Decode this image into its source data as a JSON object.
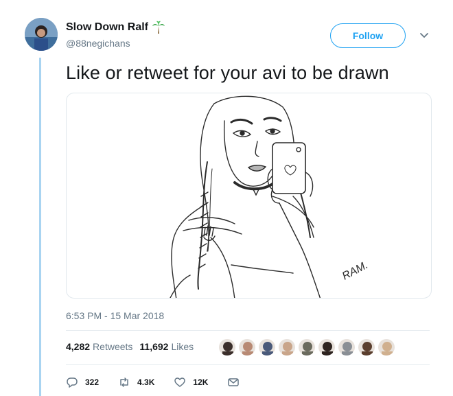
{
  "tweet": {
    "display_name": "Slow Down Ralf",
    "handle": "@88negichans",
    "follow_label": "Follow",
    "text": "Like or retweet for your avi to be drawn",
    "timestamp": "6:53 PM - 15 Mar 2018",
    "media_signature": "RAM.",
    "retweets_count": "4,282",
    "retweets_label": "Retweets",
    "likes_count": "11,692",
    "likes_label": "Likes",
    "liker_colors": [
      "#3b2f2b",
      "#b88a74",
      "#4a5a7a",
      "#c9a58a",
      "#6b6b5e",
      "#2e2420",
      "#8a8f95",
      "#5b3f2e",
      "#d0b08f"
    ]
  },
  "actions": {
    "reply_count": "322",
    "retweet_count": "4.3K",
    "like_count": "12K"
  },
  "colors": {
    "accent": "#1da1f2",
    "thread_line": "#a9d4f1",
    "muted_text": "#657786"
  },
  "icons": [
    "palm-tree-icon",
    "chevron-down-icon",
    "reply-icon",
    "retweet-icon",
    "heart-icon",
    "envelope-icon"
  ]
}
